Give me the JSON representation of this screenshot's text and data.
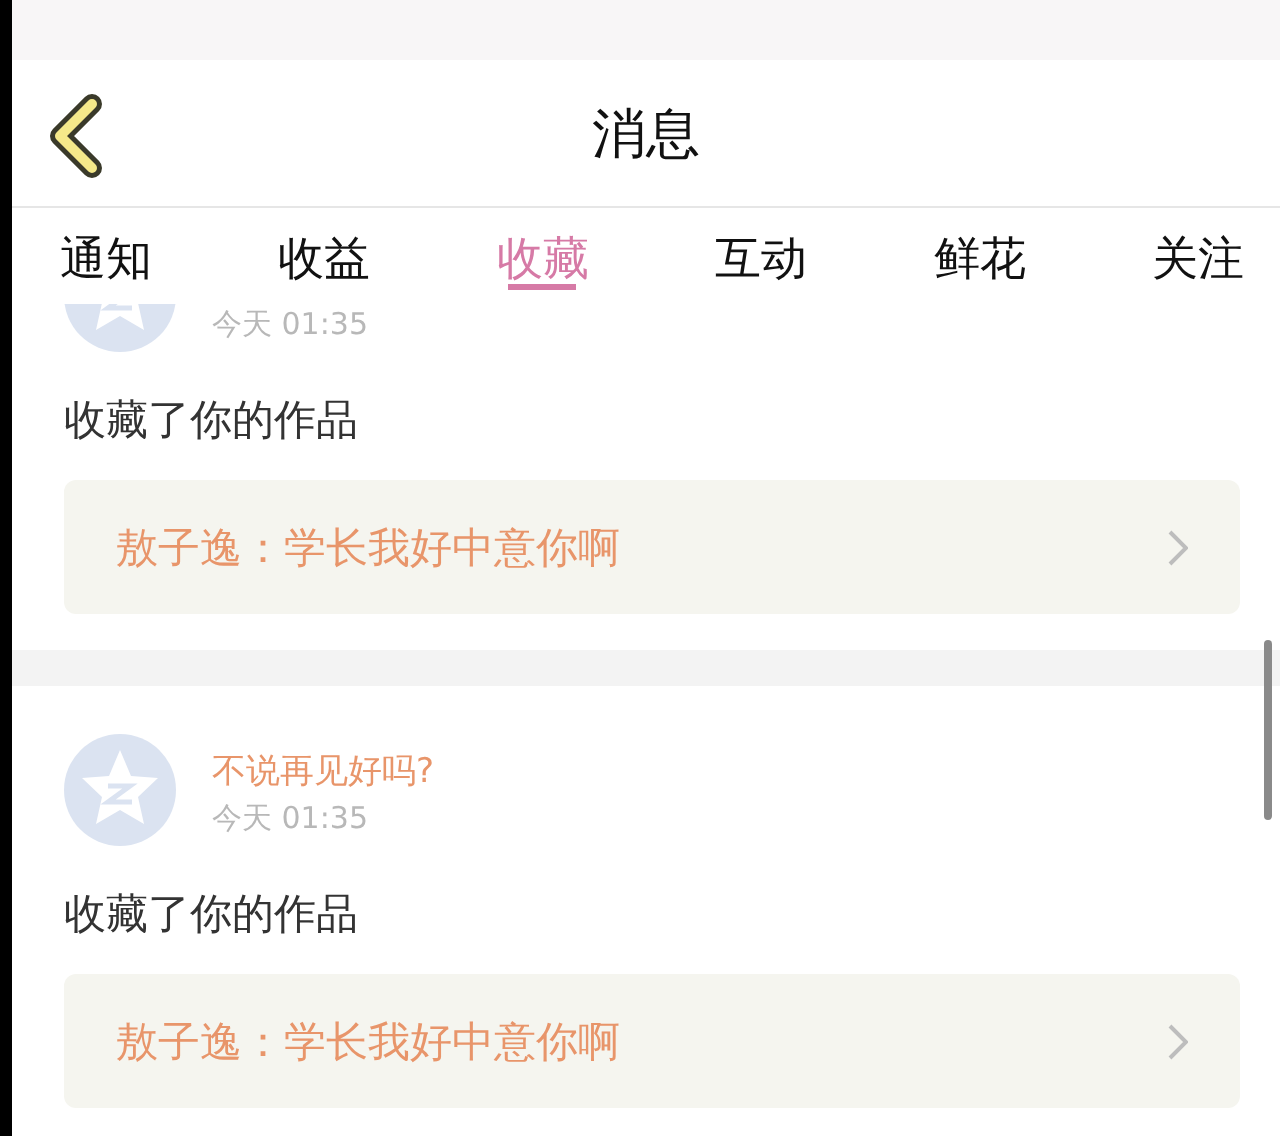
{
  "header": {
    "title": "消息"
  },
  "tabs": [
    {
      "label": "通知",
      "selected": false
    },
    {
      "label": "收益",
      "selected": false
    },
    {
      "label": "收藏",
      "selected": true
    },
    {
      "label": "互动",
      "selected": false
    },
    {
      "label": "鲜花",
      "selected": false
    },
    {
      "label": "关注",
      "selected": false
    }
  ],
  "messages": [
    {
      "time": "今天 01:35",
      "action": "收藏了你的作品",
      "work": "敖子逸：学长我好中意你啊"
    },
    {
      "user": "不说再见好吗?",
      "time": "今天 01:35",
      "action": "收藏了你的作品",
      "work": "敖子逸：学长我好中意你啊"
    }
  ]
}
